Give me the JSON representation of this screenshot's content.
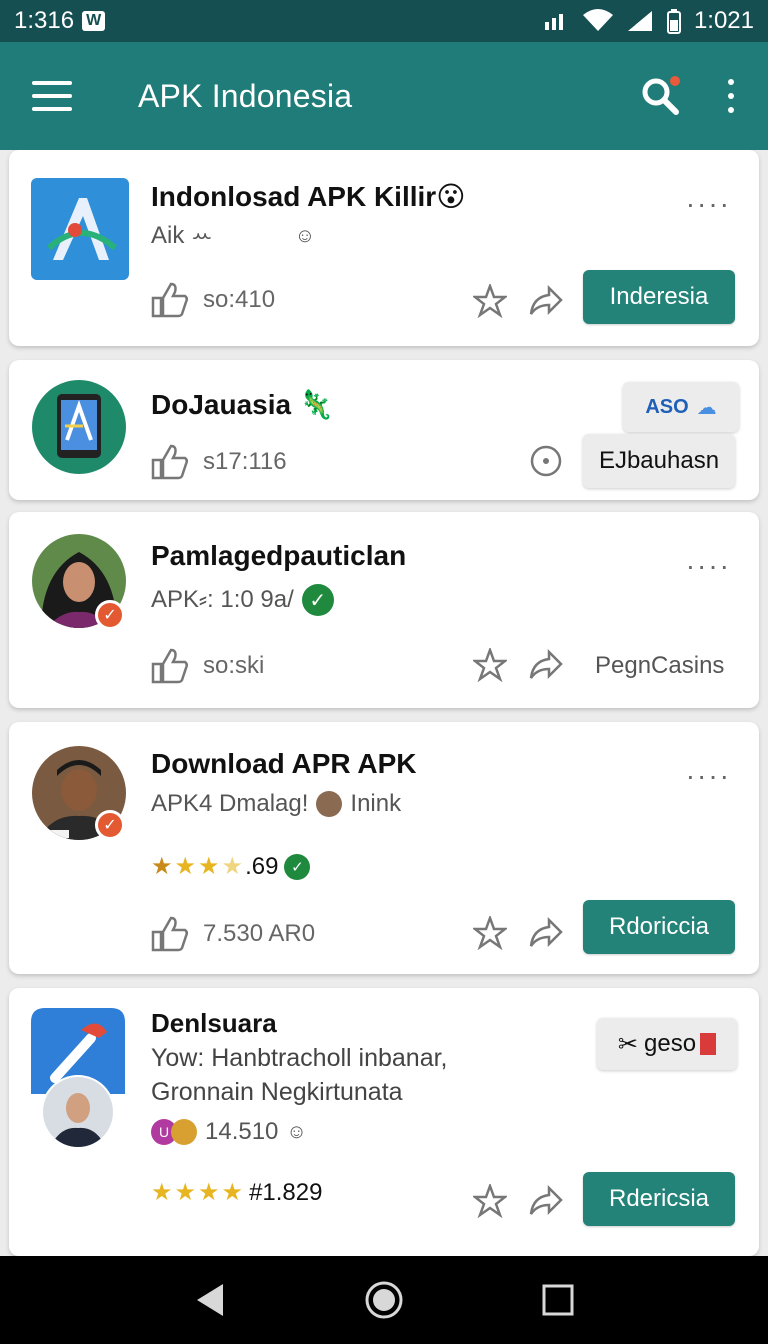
{
  "status_bar": {
    "time_left": "1:316",
    "badge": "W",
    "time_right": "1:021"
  },
  "app_bar": {
    "title": "APK Indonesia"
  },
  "cards": [
    {
      "name": "Indonlosad APK Killir",
      "emoji": "😮",
      "sub": "Aik ꕀ",
      "stat": "so:410",
      "button": "Inderesia"
    },
    {
      "name": "DoJauasia",
      "emoji": "🦎",
      "stat": "s17:116",
      "tag": "ASO",
      "button": "EJbauhasn"
    },
    {
      "name": "Pamlagedpauticlan",
      "sub": "APK⸗: 1:0 9a/",
      "stat": "so:ski",
      "link": "PegnCasins"
    },
    {
      "name": "Download APR APK",
      "sub": "APK4 Dmalag!",
      "sub2": "Inink",
      "rating": ".69",
      "stat": "7.530 AR0",
      "button": "Rdoriccia"
    },
    {
      "name": "Denlsuara",
      "sub": "Yow: Hanbtracholl inbanar,",
      "sub_line2": "Gronnain Negkirtunata",
      "count": "14.510",
      "rating": "#1.829",
      "tag": "geso",
      "button": "Rdericsia"
    }
  ],
  "colors": {
    "status_bar": "#164f52",
    "app_bar": "#207c78",
    "accent": "#238378",
    "badge": "#e35a32",
    "verified": "#1f8a3e",
    "star": "#e7b521"
  }
}
